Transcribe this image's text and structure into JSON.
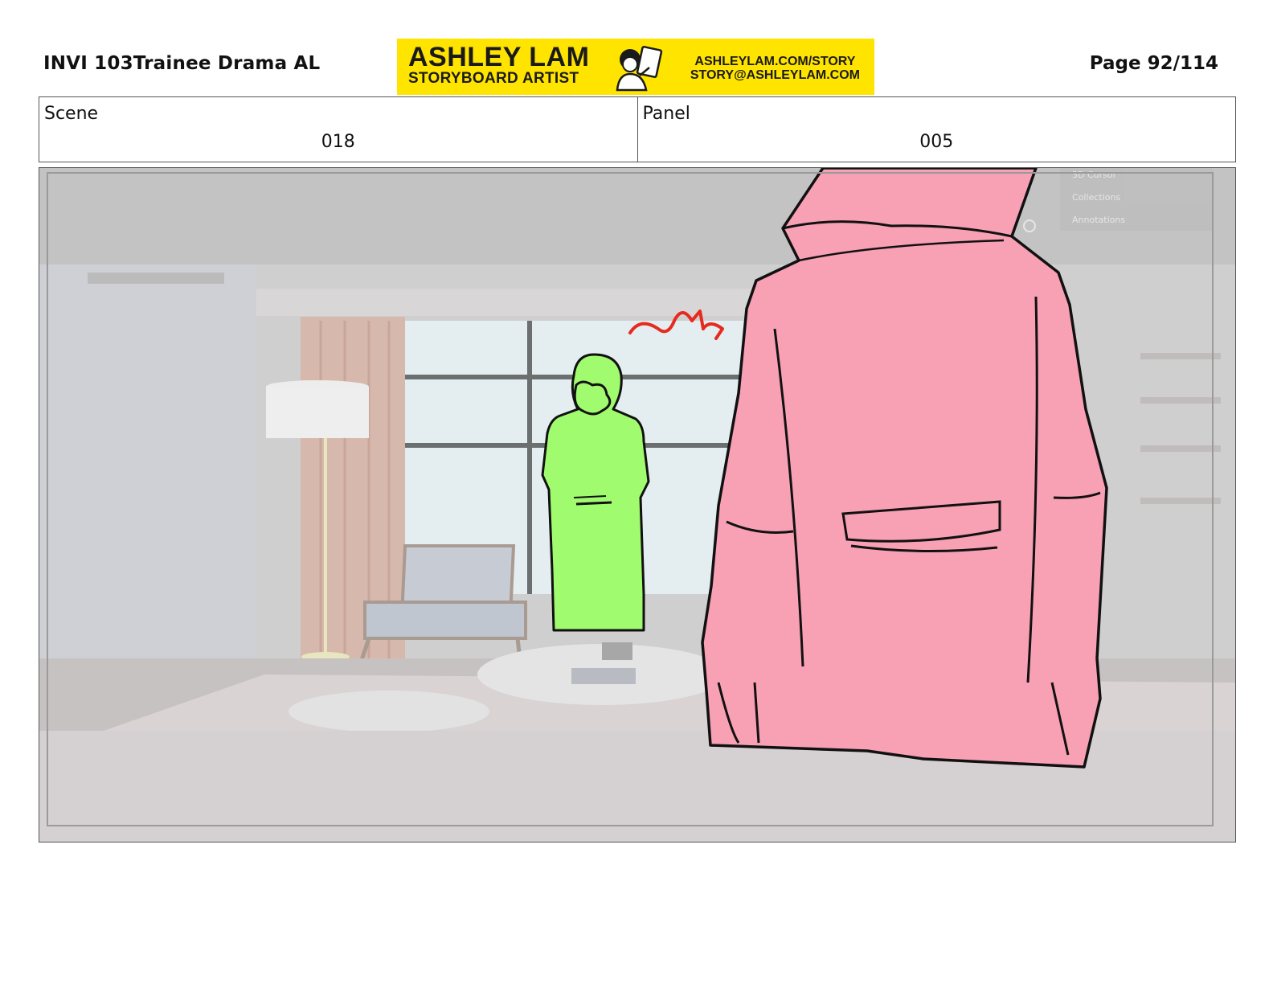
{
  "header": {
    "project": "INVI 103Trainee Drama AL",
    "page": "Page  92/114"
  },
  "banner": {
    "name": "ASHLEY LAM",
    "role": "STORYBOARD ARTIST",
    "website": "ASHLEYLAM.COM/STORY",
    "email": "STORY@ASHLEYLAM.COM",
    "bg_color": "#ffe400"
  },
  "meta": {
    "scene_label": "Scene",
    "scene_value": "018",
    "panel_label": "Panel",
    "panel_value": "005"
  },
  "panel": {
    "ui_overlay": {
      "items": [
        "3D Cursor",
        "Collections",
        "Annotations"
      ]
    },
    "colors": {
      "figure_front": "#f8a0b4",
      "figure_back": "#a1fb6e",
      "accent_stroke": "#e62a1e"
    }
  }
}
